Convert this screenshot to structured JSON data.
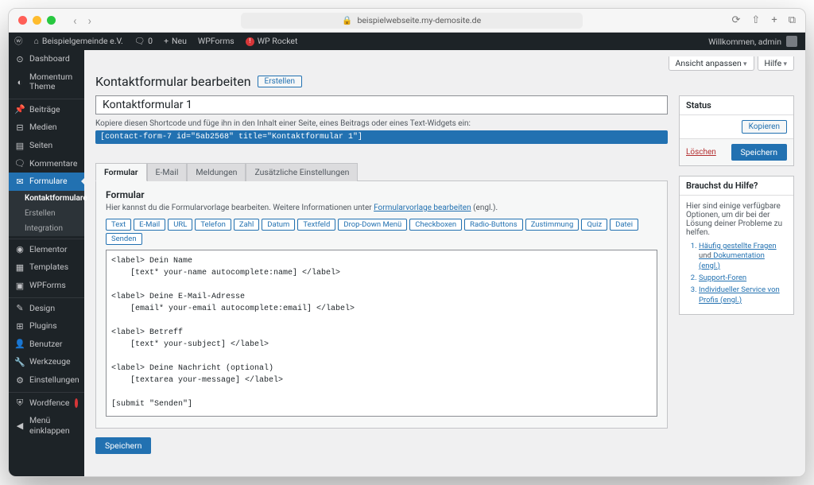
{
  "browser": {
    "url": "beispielwebseite.my-demosite.de"
  },
  "adminbar": {
    "site": "Beispielgemeinde e.V.",
    "comments": "0",
    "new": "Neu",
    "wpforms": "WPForms",
    "rocket": "WP Rocket",
    "welcome": "Willkommen, admin"
  },
  "sidebar": {
    "dashboard": "Dashboard",
    "theme": "Momentum Theme",
    "posts": "Beiträge",
    "media": "Medien",
    "pages": "Seiten",
    "comments": "Kommentare",
    "forms": "Formulare",
    "forms_sub_contact": "Kontaktformulare",
    "forms_sub_create": "Erstellen",
    "forms_sub_integration": "Integration",
    "elementor": "Elementor",
    "templates": "Templates",
    "wpforms": "WPForms",
    "design": "Design",
    "plugins": "Plugins",
    "users": "Benutzer",
    "tools": "Werkzeuge",
    "settings": "Einstellungen",
    "wordfence": "Wordfence",
    "collapse": "Menü einklappen"
  },
  "screen_meta": {
    "options": "Ansicht anpassen",
    "help": "Hilfe"
  },
  "header": {
    "title": "Kontaktformular bearbeiten",
    "action": "Erstellen"
  },
  "form": {
    "title_value": "Kontaktformular 1",
    "shortcode_label": "Kopiere diesen Shortcode und füge ihn in den Inhalt einer Seite, eines Beitrags oder eines Text-Widgets ein:",
    "shortcode": "[contact-form-7 id=\"5ab2568\" title=\"Kontaktformular 1\"]"
  },
  "tabs": {
    "form": "Formular",
    "mail": "E-Mail",
    "messages": "Meldungen",
    "additional": "Zusätzliche Einstellungen"
  },
  "panel": {
    "title": "Formular",
    "desc_1": "Hier kannst du die Formularvorlage bearbeiten. Weitere Informationen unter ",
    "desc_link": "Formularvorlage bearbeiten",
    "desc_2": " (engl.).",
    "tags": [
      "Text",
      "E-Mail",
      "URL",
      "Telefon",
      "Zahl",
      "Datum",
      "Textfeld",
      "Drop-Down Menü",
      "Checkboxen",
      "Radio-Buttons",
      "Zustimmung",
      "Quiz",
      "Datei",
      "Senden"
    ],
    "code": "<label> Dein Name\n    [text* your-name autocomplete:name] </label>\n\n<label> Deine E-Mail-Adresse\n    [email* your-email autocomplete:email] </label>\n\n<label> Betreff\n    [text* your-subject] </label>\n\n<label> Deine Nachricht (optional)\n    [textarea your-message] </label>\n\n[submit \"Senden\"]"
  },
  "buttons": {
    "save": "Speichern",
    "copy": "Kopieren",
    "delete": "Löschen"
  },
  "metabox": {
    "status_title": "Status",
    "help_title": "Brauchst du Hilfe?",
    "help_desc": "Hier sind einige verfügbare Optionen, um dir bei der Lösung deiner Probleme zu helfen.",
    "help_links": {
      "l1a": "Häufig gestellte Fragen",
      "l1b": " und ",
      "l1c": "Dokumentation (engl.)",
      "l2": "Support-Foren",
      "l3": "Individueller Service von Profis (engl.)"
    }
  }
}
